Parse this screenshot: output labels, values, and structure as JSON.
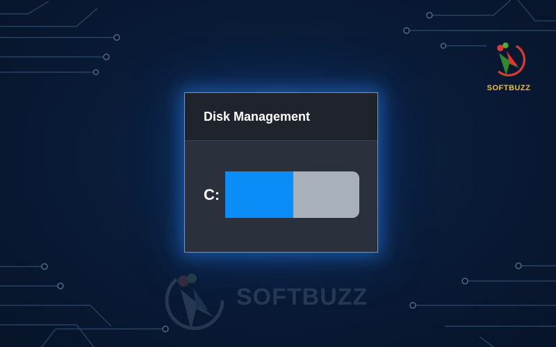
{
  "window": {
    "title": "Disk Management"
  },
  "drives": [
    {
      "label": "C:",
      "used_fraction": 0.51
    }
  ],
  "branding": {
    "logo_text": "SOFTBUZZ",
    "watermark_text": "SOFTBUZZ"
  },
  "colors": {
    "accent": "#0a8df7",
    "bar_track": "#a7b0bb",
    "window_border": "#4aa3f0",
    "logo_text": "#e8c235"
  }
}
